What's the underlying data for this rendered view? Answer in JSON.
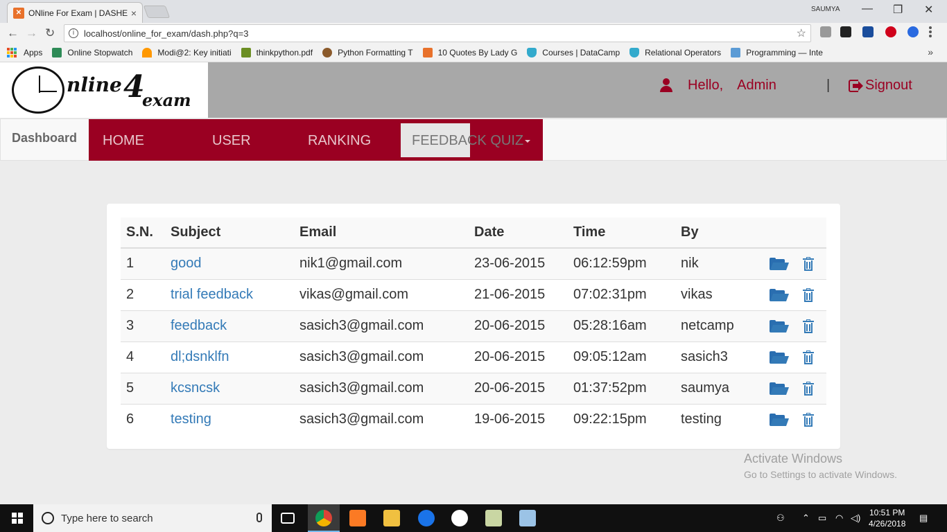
{
  "browser": {
    "tab_title": "ONline For Exam | DASHE",
    "tab_close": "×",
    "user_name": "SAUMYA",
    "url": "localhost/online_for_exam/dash.php?q=3",
    "minimize": "—",
    "maximize": "❐",
    "close": "✕",
    "back": "←",
    "forward": "→",
    "reload": "↻",
    "info": "i",
    "star": "☆",
    "bookmarks_more": "»",
    "bookmarks": [
      {
        "label": "Apps",
        "color": "#e44d26"
      },
      {
        "label": "Online Stopwatch",
        "color": "#2e8b57"
      },
      {
        "label": "Modi@2: Key initiati",
        "color": "#ff9800"
      },
      {
        "label": "thinkpython.pdf",
        "color": "#6b8e23"
      },
      {
        "label": "Python Formatting T",
        "color": "#8b5a2b"
      },
      {
        "label": "10 Quotes By Lady G",
        "color": "#e8712b"
      },
      {
        "label": "Courses | DataCamp",
        "color": "#3ac"
      },
      {
        "label": "Relational Operators",
        "color": "#3ac"
      },
      {
        "label": "Programming — Inte",
        "color": "#5b9bd5"
      }
    ]
  },
  "header": {
    "logo_online": "nline",
    "logo_4": "4",
    "logo_exam": "exam",
    "hello": "Hello,",
    "user": "Admin",
    "separator": "|",
    "signout": "Signout"
  },
  "nav": {
    "brand": "Dashboard",
    "items": [
      "HOME",
      "USER",
      "RANKING"
    ],
    "feedback": "FEEDBACK",
    "quiz": "QUIZ"
  },
  "table": {
    "headers": [
      "S.N.",
      "Subject",
      "Email",
      "Date",
      "Time",
      "By"
    ],
    "rows": [
      {
        "sn": "1",
        "subject": "good",
        "email": "nik1@gmail.com",
        "date": "23-06-2015",
        "time": "06:12:59pm",
        "by": "nik"
      },
      {
        "sn": "2",
        "subject": "trial feedback",
        "email": "vikas@gmail.com",
        "date": "21-06-2015",
        "time": "07:02:31pm",
        "by": "vikas"
      },
      {
        "sn": "3",
        "subject": "feedback",
        "email": "sasich3@gmail.com",
        "date": "20-06-2015",
        "time": "05:28:16am",
        "by": "netcamp"
      },
      {
        "sn": "4",
        "subject": "dl;dsnklfn",
        "email": "sasich3@gmail.com",
        "date": "20-06-2015",
        "time": "09:05:12am",
        "by": "sasich3"
      },
      {
        "sn": "5",
        "subject": "kcsncsk",
        "email": "sasich3@gmail.com",
        "date": "20-06-2015",
        "time": "01:37:52pm",
        "by": "saumya"
      },
      {
        "sn": "6",
        "subject": "testing",
        "email": "sasich3@gmail.com",
        "date": "19-06-2015",
        "time": "09:22:15pm",
        "by": "testing"
      }
    ]
  },
  "watermark": {
    "line1": "Activate Windows",
    "line2": "Go to Settings to activate Windows."
  },
  "taskbar": {
    "search_placeholder": "Type here to search",
    "time": "10:51 PM",
    "date": "4/26/2018"
  }
}
